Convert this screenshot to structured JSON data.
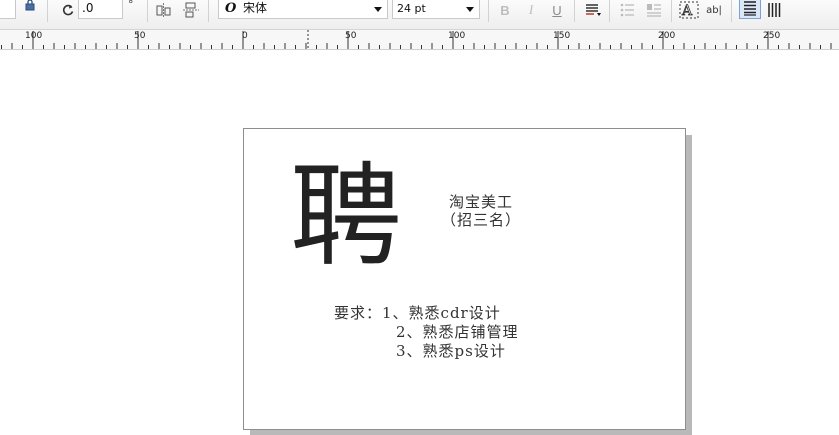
{
  "toolbar": {
    "rotation_value": ".0",
    "degree_symbol": "°",
    "font_style_glyph": "O",
    "font_name": "宋体",
    "font_size": "24 pt",
    "icons": [
      "lock-icon",
      "rotate-icon",
      "mirror-horizontal-icon",
      "mirror-vertical-icon",
      "bold-icon",
      "italic-icon",
      "underline-icon",
      "text-align-icon",
      "bullet-list-icon",
      "drop-cap-icon",
      "text-frame-icon",
      "edit-text-icon",
      "text-horizontal-icon",
      "text-vertical-icon"
    ]
  },
  "ruler": {
    "labels": [
      "100",
      "50",
      "0",
      "50",
      "100",
      "150",
      "200",
      "250"
    ]
  },
  "document": {
    "big_char": "聘",
    "title_line1": "淘宝美工",
    "title_line2": "（招三名）",
    "req_line1": "要求：1、熟悉cdr设计",
    "req_line2": "2、熟悉店铺管理",
    "req_line3": "3、熟悉ps设计"
  }
}
